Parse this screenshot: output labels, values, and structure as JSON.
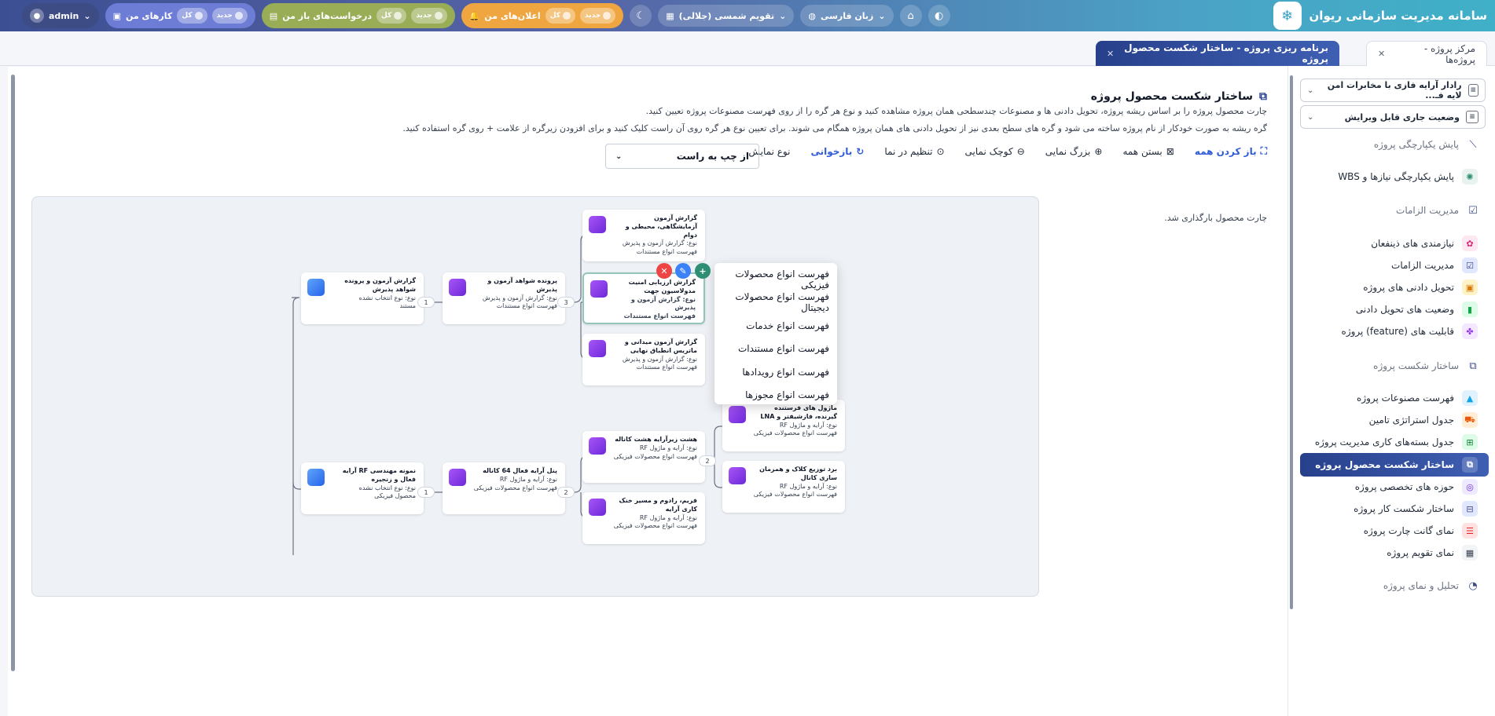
{
  "app": {
    "title": "سامانه مدیریت سازمانی ریوان"
  },
  "topbar": {
    "user": "admin",
    "tasks": {
      "label": "کارهای من",
      "all": "کل",
      "new": "جدید"
    },
    "requests": {
      "label": "درخواست‌های باز من",
      "all": "کل",
      "new": "جدید"
    },
    "notifications": {
      "label": "اعلان‌های من",
      "all": "کل",
      "new": "جدید"
    },
    "calendar": "تقویم شمسی (جلالی)",
    "language": "زبان فارسی"
  },
  "tabs": [
    {
      "label": "مرکز پروژه - پروژه‌ها"
    },
    {
      "label": "برنامه ریزی پروژه - ساختار شکست محصول پروژه"
    }
  ],
  "sidebar": {
    "project_select": "رادار آرایه فازی با مخابرات امن لایه فـ...",
    "state_select": "وضعیت جاری قابل ویرایش",
    "sections": [
      "پایش یکپارچگی پروژه",
      "مدیریت الزامات",
      "ساختار شکست پروژه",
      "تحلیل و نمای پروژه"
    ],
    "items": [
      "پایش یکپارچگی نیازها و WBS",
      "نیازمندی های ذینفعان",
      "مدیریت الزامات",
      "تحویل دادنی های پروژه",
      "وضعیت های تحویل دادنی",
      "قابلیت های (feature) پروژه",
      "فهرست مصنوعات پروژه",
      "جدول استراتژی تامین",
      "جدول بسته‌های کاری مدیریت پروژه",
      "ساختار شکست محصول پروژه",
      "حوزه های تخصصی پروژه",
      "ساختار شکست کار پروژه",
      "نمای گانت چارت پروژه",
      "نمای تقویم پروژه"
    ]
  },
  "main": {
    "title": "ساختار شکست محصول پروژه",
    "desc1": "چارت محصول پروژه را بر اساس ریشه پروژه، تحویل دادنی ها و مصنوعات چندسطحی همان پروژه مشاهده کنید و نوع هر گره را از روی فهرست مصنوعات پروژه تعیین کنید.",
    "desc2": "گره ریشه به صورت خودکار از نام پروژه ساخته می شود و گره های سطح بعدی نیز از تحویل دادنی های همان پروژه همگام می شوند. برای تعیین نوع هر گره روی آن راست کلیک کنید و برای افزودن زیرگره از علامت + روی گره استفاده کنید.",
    "toolbar": {
      "expand_all": "باز کردن همه",
      "collapse_all": "بستن همه",
      "zoom_in": "بزرگ نمایی",
      "zoom_out": "کوچک نمایی",
      "fit": "تنظیم در نما",
      "reload": "بازخوانی",
      "display_type": "نوع نمایش",
      "direction": "از چپ به راست"
    },
    "status": "چارت محصول بارگذاری شد."
  },
  "chart": {
    "nodes": [
      {
        "id": "n1",
        "title": "گزارش آزمون و پرونده شواهد پذیرش",
        "l1": "نوع: نوع انتخاب نشده",
        "l2": "مستند"
      },
      {
        "id": "n2",
        "title": "پرونده شواهد آزمون و پذیرش",
        "l1": "نوع: گزارش آزمون و پذیرش",
        "l2": "فهرست انواع مستندات"
      },
      {
        "id": "n3",
        "title": "گزارش آزمون آزمایشگاهی، محیطی و دوام",
        "l1": "نوع: گزارش آزمون و پذیرش",
        "l2": "فهرست انواع مستندات"
      },
      {
        "id": "n4",
        "title": "گزارش ارزیابی امنیت مدولاسیون جهت",
        "l1": "نوع: گزارش آزمون و پذیرش",
        "l2": "فهرست انواع مستندات"
      },
      {
        "id": "n5",
        "title": "گزارش آزمون میدانی و ماتریس انطباق نهایی",
        "l1": "نوع: گزارش آزمون و پذیرش",
        "l2": "فهرست انواع مستندات"
      },
      {
        "id": "n6",
        "title": "نمونه مهندسی RF آرایه فعال و زنجیره",
        "l1": "نوع: نوع انتخاب نشده",
        "l2": "محصول فیزیکی"
      },
      {
        "id": "n7",
        "title": "پنل آرایه فعال 64 کاناله",
        "l1": "نوع: آرایه و ماژول RF",
        "l2": "فهرست انواع محصولات فیزیکی"
      },
      {
        "id": "n8",
        "title": "هشت زیرآرایه هشت کاناله",
        "l1": "نوع: آرایه و ماژول RF",
        "l2": "فهرست انواع محصولات فیزیکی"
      },
      {
        "id": "n9",
        "title": "فریم، رادوم و مسیر خنک کاری آرایه",
        "l1": "نوع: آرایه و ماژول RF",
        "l2": "فهرست انواع محصولات فیزیکی"
      },
      {
        "id": "n10",
        "title": "ماژول های فرستنده گیرنده، فازشیفتر و LNA",
        "l1": "نوع: آرایه و ماژول RF",
        "l2": "فهرست انواع محصولات فیزیکی"
      },
      {
        "id": "n11",
        "title": "برد توزیع کلاک و همزمان سازی کانال",
        "l1": "نوع: آرایه و ماژول RF",
        "l2": "فهرست انواع محصولات فیزیکی"
      }
    ],
    "badges": [
      "1",
      "3",
      "1",
      "2",
      "2"
    ],
    "context_menu": [
      "فهرست انواع محصولات فیزیکی",
      "فهرست انواع محصولات دیجیتال",
      "فهرست انواع خدمات",
      "فهرست انواع مستندات",
      "فهرست انواع رویدادها",
      "فهرست انواع مجوزها"
    ]
  }
}
